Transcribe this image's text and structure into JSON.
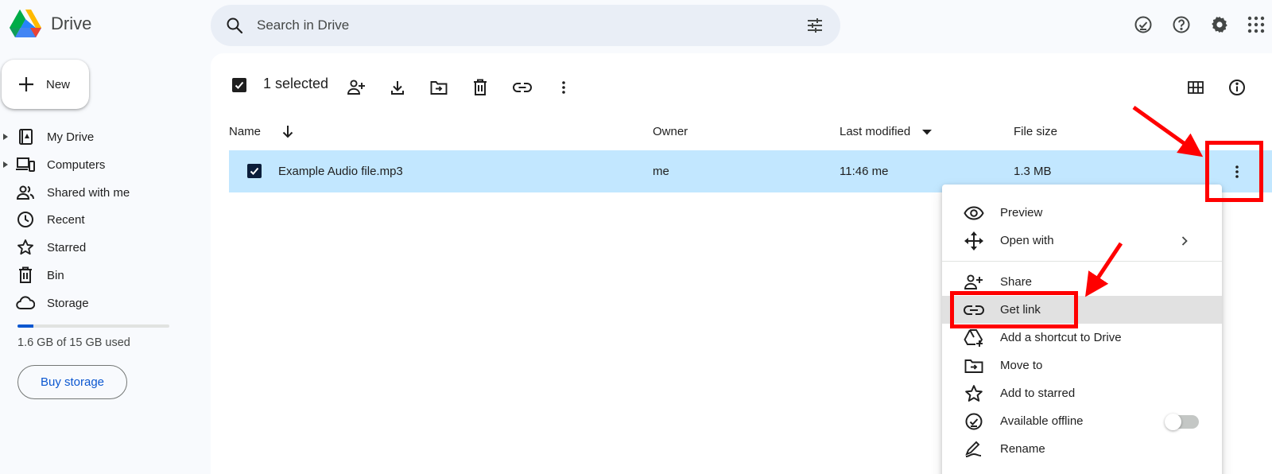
{
  "app": {
    "title": "Drive"
  },
  "search": {
    "placeholder": "Search in Drive"
  },
  "header_icons": [
    "ready-for-offline-icon",
    "help-icon",
    "settings-icon",
    "apps-grid-icon"
  ],
  "sidebar": {
    "new_label": "New",
    "items": [
      {
        "label": "My Drive",
        "icon": "my-drive-icon",
        "expandable": true
      },
      {
        "label": "Computers",
        "icon": "computers-icon",
        "expandable": true
      },
      {
        "label": "Shared with me",
        "icon": "shared-icon",
        "expandable": false
      },
      {
        "label": "Recent",
        "icon": "clock-icon",
        "expandable": false
      },
      {
        "label": "Starred",
        "icon": "star-icon",
        "expandable": false
      },
      {
        "label": "Bin",
        "icon": "trash-icon",
        "expandable": false
      },
      {
        "label": "Storage",
        "icon": "cloud-icon",
        "expandable": false
      }
    ],
    "storage": {
      "used_fraction": 0.107,
      "text": "1.6 GB of 15 GB used"
    },
    "buy_label": "Buy storage"
  },
  "toolbar": {
    "selected_text": "1 selected",
    "actions": [
      "share-icon",
      "download-icon",
      "move-icon",
      "trash-icon",
      "link-icon",
      "more-vert-icon"
    ],
    "view_icons": [
      "grid-view-icon",
      "info-icon"
    ]
  },
  "table": {
    "columns": {
      "name": "Name",
      "owner": "Owner",
      "modified": "Last modified",
      "size": "File size"
    },
    "rows": [
      {
        "name": "Example Audio file.mp3",
        "owner": "me",
        "modified": "11:46 me",
        "size": "1.3 MB",
        "selected": true
      }
    ]
  },
  "context_menu": {
    "items": [
      {
        "label": "Preview",
        "icon": "eye-icon"
      },
      {
        "label": "Open with",
        "icon": "open-with-icon",
        "submenu": true
      },
      {
        "label": "Share",
        "icon": "share-icon"
      },
      {
        "label": "Get link",
        "icon": "link-icon",
        "highlighted": true
      },
      {
        "label": "Add a shortcut to Drive",
        "icon": "add-shortcut-icon"
      },
      {
        "label": "Move to",
        "icon": "move-icon"
      },
      {
        "label": "Add to starred",
        "icon": "star-icon"
      },
      {
        "label": "Available offline",
        "icon": "offline-icon",
        "toggle": false
      },
      {
        "label": "Rename",
        "icon": "rename-icon"
      }
    ]
  },
  "colors": {
    "selected_row": "#c2e7ff",
    "accent": "#0b57d0",
    "annotation": "#ff0000"
  }
}
